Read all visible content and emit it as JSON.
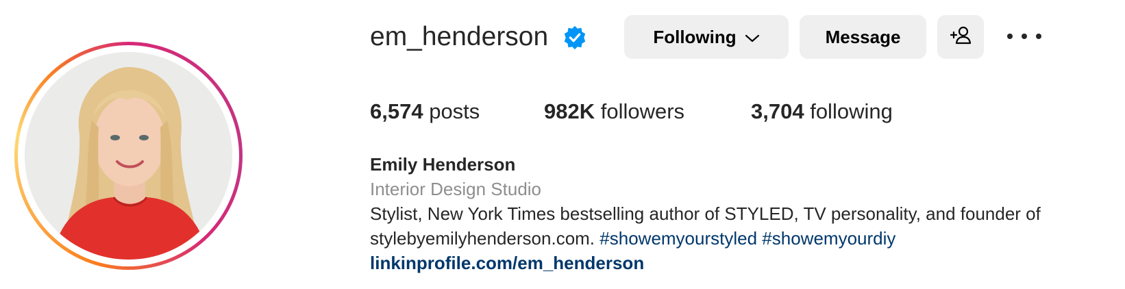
{
  "profile": {
    "username": "em_henderson",
    "verified": true,
    "avatar_alt": "profile-photo",
    "buttons": {
      "following": "Following",
      "message": "Message"
    },
    "stats": {
      "posts_count": "6,574",
      "posts_label": "posts",
      "followers_count": "982K",
      "followers_label": "followers",
      "following_count": "3,704",
      "following_label": "following"
    },
    "full_name": "Emily Henderson",
    "category": "Interior Design Studio",
    "bio_line1": "Stylist, New York Times bestselling author of STYLED, TV personality, and founder of",
    "bio_line2_text": "stylebyemilyhenderson.com.",
    "hashtags": [
      "#showemyourstyled",
      "#showemyourdiy"
    ],
    "link": "linkinprofile.com/em_henderson"
  },
  "colors": {
    "link_blue": "#00376b",
    "verified_blue": "#0095f6",
    "muted_gray": "#8e8e8e",
    "button_bg": "#efefef"
  },
  "icons": {
    "verified": "verified-badge-icon",
    "chevron": "chevron-down-icon",
    "suggest": "add-person-icon",
    "more": "more-options-icon"
  }
}
